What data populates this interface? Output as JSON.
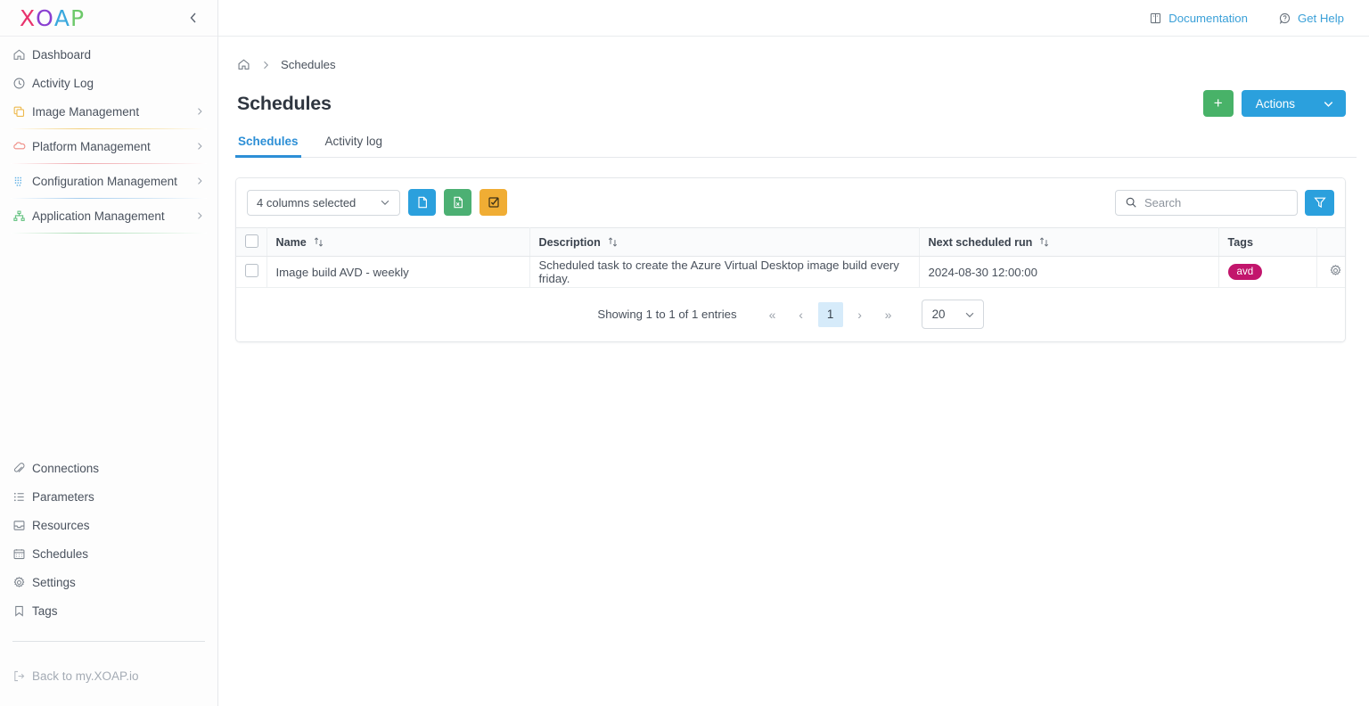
{
  "sidebar": {
    "logo": {
      "part1": "X",
      "part2": "O",
      "part3": "A",
      "part4": "P"
    },
    "collapse_icon": "chevron-left-icon",
    "primary_items": [
      {
        "label": "Dashboard",
        "icon": "home-icon",
        "has_chevron": false
      },
      {
        "label": "Activity Log",
        "icon": "clock-icon",
        "has_chevron": false
      },
      {
        "label": "Image Management",
        "icon": "layers-icon",
        "has_chevron": true
      },
      {
        "label": "Platform Management",
        "icon": "cloud-icon",
        "has_chevron": true
      },
      {
        "label": "Configuration Management",
        "icon": "grid-dots-icon",
        "has_chevron": true
      },
      {
        "label": "Application Management",
        "icon": "sitemap-icon",
        "has_chevron": true
      }
    ],
    "secondary_items": [
      {
        "label": "Connections",
        "icon": "paperclip-icon"
      },
      {
        "label": "Parameters",
        "icon": "list-icon"
      },
      {
        "label": "Resources",
        "icon": "inbox-icon"
      },
      {
        "label": "Schedules",
        "icon": "calendar-icon"
      },
      {
        "label": "Settings",
        "icon": "gear-icon"
      },
      {
        "label": "Tags",
        "icon": "bookmark-icon"
      }
    ],
    "back_link": {
      "label": "Back to my.XOAP.io",
      "icon": "logout-icon"
    }
  },
  "topbar": {
    "documentation": {
      "label": "Documentation",
      "icon": "book-icon"
    },
    "get_help": {
      "label": "Get Help",
      "icon": "question-bubble-icon"
    }
  },
  "breadcrumb": {
    "home_icon": "home-icon",
    "separator": "›",
    "current": "Schedules"
  },
  "page": {
    "title": "Schedules",
    "add_button": "+",
    "actions_button": "Actions",
    "actions_chevron": "chevron-down-icon"
  },
  "tabs": [
    {
      "label": "Schedules",
      "active": true
    },
    {
      "label": "Activity log",
      "active": false
    }
  ],
  "toolbar": {
    "columns_select": "4 columns selected",
    "columns_chevron": "chevron-down-icon",
    "export_buttons": [
      {
        "name": "export-csv-button",
        "icon": "file-icon",
        "color": "#2ba0dd"
      },
      {
        "name": "export-excel-button",
        "icon": "file-excel-icon",
        "color": "#4cb073"
      },
      {
        "name": "select-all-button",
        "icon": "checkbox-checked-icon",
        "color": "#f0ad34"
      }
    ],
    "search_placeholder": "Search",
    "search_value": "",
    "search_icon": "search-icon",
    "filter_icon": "filter-funnel-icon"
  },
  "table": {
    "columns": [
      {
        "key": "name",
        "label": "Name",
        "sortable": true
      },
      {
        "key": "description",
        "label": "Description",
        "sortable": true
      },
      {
        "key": "next_run",
        "label": "Next scheduled run",
        "sortable": true
      },
      {
        "key": "tags",
        "label": "Tags",
        "sortable": false
      }
    ],
    "sort_icon": "sort-arrows-icon",
    "rows": [
      {
        "name": "Image build AVD - weekly",
        "description": "Scheduled task to create the Azure Virtual Desktop image build every friday.",
        "next_run": "2024-08-30 12:00:00",
        "tags": [
          "avd"
        ],
        "row_action_icon": "gear-icon"
      }
    ]
  },
  "pagination": {
    "info": "Showing 1 to 1 of 1 entries",
    "first": "«",
    "prev": "‹",
    "current_page": "1",
    "next": "›",
    "last": "»",
    "page_size": "20",
    "page_size_chevron": "chevron-down-icon"
  },
  "colors": {
    "accent_blue": "#2ba0dd",
    "green": "#48b268",
    "orange": "#f0ad34",
    "tag_magenta": "#c2156c",
    "page_active": "#d6ebfa"
  }
}
